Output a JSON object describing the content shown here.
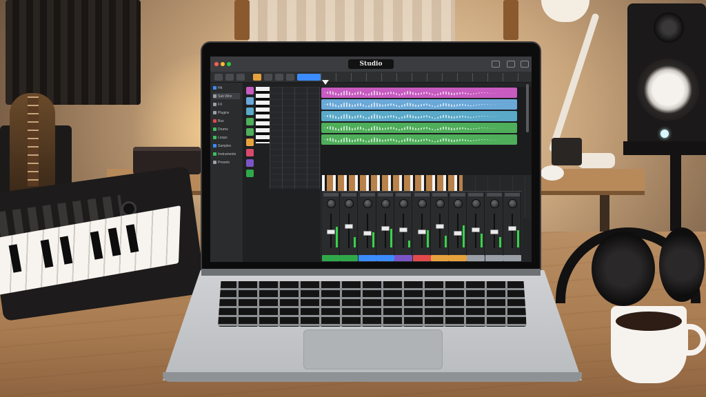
{
  "app": {
    "title": "Studio"
  },
  "browser": {
    "items": [
      {
        "label": "Hit",
        "icon_color": "#3b8cff",
        "selected": false
      },
      {
        "label": "Sub Wire",
        "icon_color": "#9aa0a6",
        "selected": true
      },
      {
        "label": "FX",
        "icon_color": "#9aa0a6",
        "selected": false
      },
      {
        "label": "Plugins",
        "icon_color": "#9aa0a6",
        "selected": false
      },
      {
        "label": "Bus",
        "icon_color": "#e24a4a",
        "selected": false
      },
      {
        "label": "Drums",
        "icon_color": "#3bbf5b",
        "selected": false
      },
      {
        "label": "Loops",
        "icon_color": "#3bbf5b",
        "selected": false
      },
      {
        "label": "Samples",
        "icon_color": "#3b8cff",
        "selected": false
      },
      {
        "label": "Instruments",
        "icon_color": "#3bbf5b",
        "selected": false
      },
      {
        "label": "Presets",
        "icon_color": "#9aa0a6",
        "selected": false
      }
    ]
  },
  "tracks": [
    {
      "color": "#c75bc0",
      "icon": "waveform-icon"
    },
    {
      "color": "#6aa8d8",
      "icon": "waveform-icon"
    },
    {
      "color": "#5aa9c9",
      "icon": "waveform-icon"
    },
    {
      "color": "#4fae5a",
      "icon": "waveform-icon"
    },
    {
      "color": "#4fae5a",
      "icon": "waveform-icon"
    },
    {
      "color": "#e6a23c",
      "icon": "piano-icon"
    },
    {
      "color": "#d84a6b",
      "icon": "piano-icon"
    },
    {
      "color": "#7b55c6",
      "icon": "piano-icon"
    },
    {
      "color": "#2fa84a",
      "icon": "piano-icon"
    }
  ],
  "mixer": {
    "channels": [
      {
        "color": "#2fa84a",
        "fader": 0.55,
        "meter": 0.6
      },
      {
        "color": "#2fa84a",
        "fader": 0.7,
        "meter": 0.3
      },
      {
        "color": "#3b8cff",
        "fader": 0.5,
        "meter": 0.45
      },
      {
        "color": "#3b8cff",
        "fader": 0.65,
        "meter": 0.55
      },
      {
        "color": "#7b55c6",
        "fader": 0.6,
        "meter": 0.2
      },
      {
        "color": "#e24a4a",
        "fader": 0.55,
        "meter": 0.5
      },
      {
        "color": "#e6a23c",
        "fader": 0.7,
        "meter": 0.35
      },
      {
        "color": "#e6a23c",
        "fader": 0.5,
        "meter": 0.65
      },
      {
        "color": "#9aa0a6",
        "fader": 0.6,
        "meter": 0.4
      },
      {
        "color": "#9aa0a6",
        "fader": 0.55,
        "meter": 0.3
      },
      {
        "color": "#9aa0a6",
        "fader": 0.65,
        "meter": 0.5
      }
    ]
  },
  "colors": {
    "accent": "#3b8cff",
    "panel": "#242527"
  }
}
